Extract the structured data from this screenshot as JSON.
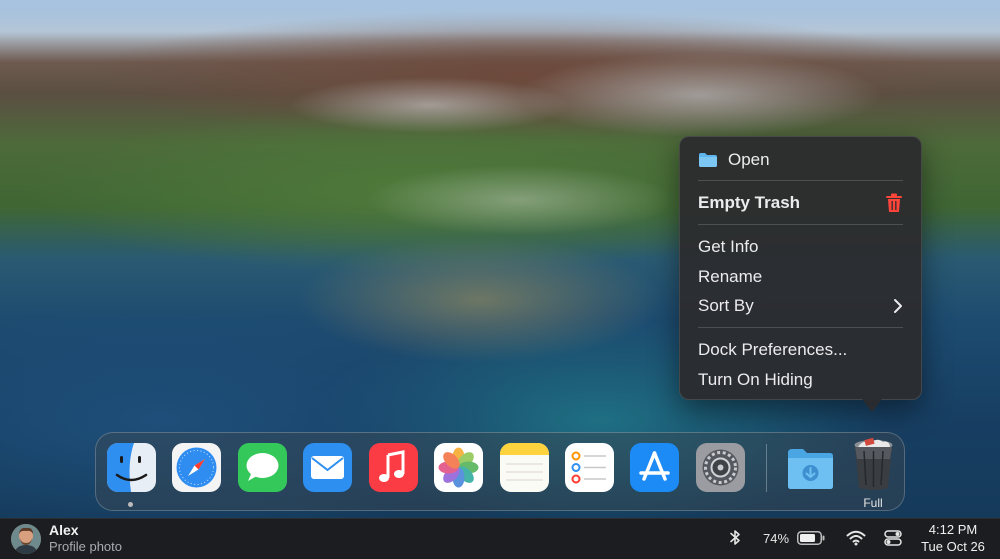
{
  "context_menu": {
    "items": [
      {
        "label": "Open",
        "icon": "folder-icon"
      },
      {
        "label": "Empty Trash",
        "icon": "trash-icon",
        "bold": true
      },
      {
        "label": "Get Info"
      },
      {
        "label": "Rename"
      },
      {
        "label": "Sort By",
        "icon": "chevron-right-icon"
      },
      {
        "label": "Dock Preferences..."
      },
      {
        "label": "Turn On Hiding"
      }
    ]
  },
  "dock": {
    "apps": [
      {
        "name": "finder-icon"
      },
      {
        "name": "safari-icon"
      },
      {
        "name": "messages-icon"
      },
      {
        "name": "mail-icon"
      },
      {
        "name": "music-icon"
      },
      {
        "name": "photos-icon"
      },
      {
        "name": "notes-icon"
      },
      {
        "name": "reminders-icon"
      },
      {
        "name": "app-store-icon"
      },
      {
        "name": "system-preferences-icon"
      },
      {
        "name": "downloads-folder-icon"
      },
      {
        "name": "trash-full-icon"
      }
    ],
    "trash_label": "Full"
  },
  "taskbar": {
    "user_name": "Alex",
    "user_subtitle": "Profile photo",
    "battery": "74%",
    "time": "4:12 PM",
    "date": "Tue Oct 26"
  },
  "colors": {
    "menu_bg": "#2c2c2e",
    "trash_red": "#ff453a",
    "folder_blue": "#5fb6ee"
  }
}
